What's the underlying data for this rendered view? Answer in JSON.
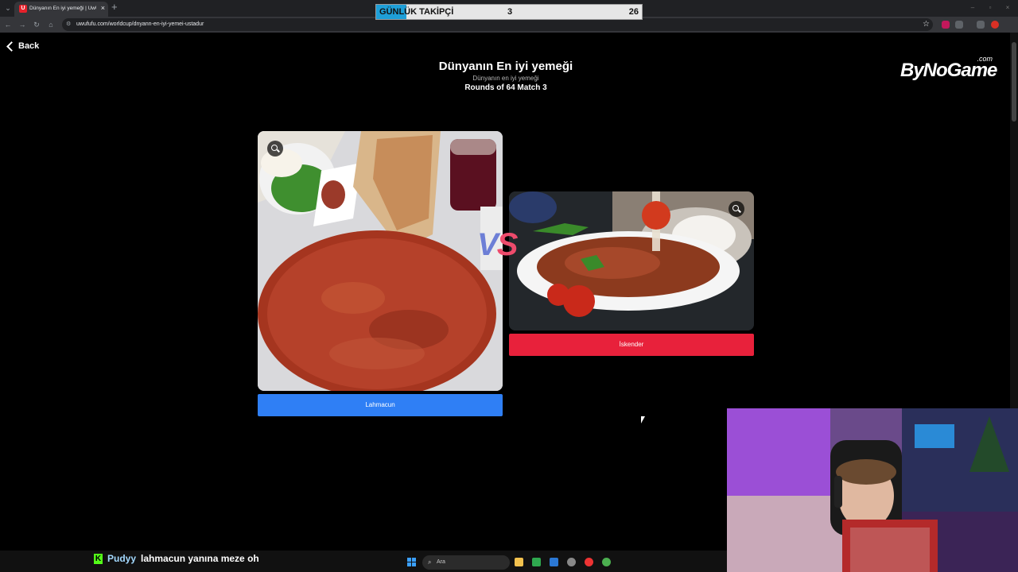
{
  "browser": {
    "tab_title": "Dünyanın En iyi yemeği | UwU",
    "tab_favicon": "U",
    "url": "uwufufu.com/worldcup/dnyann-en-iyi-yemei-ustadur"
  },
  "overlay": {
    "follower_label": "GÜNLÜK TAKİPÇİ",
    "follower_current": "3",
    "follower_goal": "26",
    "follower_progress": 0.115
  },
  "page": {
    "back_label": "Back",
    "title": "Dünyanın En iyi yemeği",
    "subtitle": "Dünyanın en iyi yemeği",
    "round_info": "Rounds of 64 Match 3",
    "logo_main": "ByNoGame",
    "logo_sub": ".com",
    "vs_v": "V",
    "vs_s": "S"
  },
  "candidates": {
    "left": {
      "label": "Lahmacun",
      "image": "lahmacun-photo",
      "color": "#2f7ff5"
    },
    "right": {
      "label": "İskender",
      "image": "iskender-photo",
      "color": "#e8213b"
    }
  },
  "chat": {
    "badge": "K",
    "username": "Pudyy",
    "message": "lahmacun yanına meze oh"
  },
  "taskbar": {
    "search_placeholder": "Ara"
  }
}
